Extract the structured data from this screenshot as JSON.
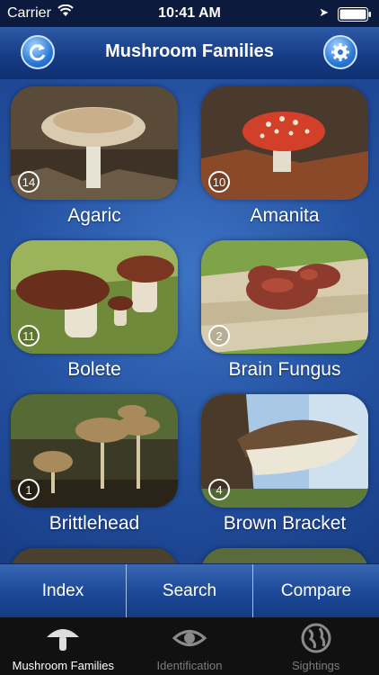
{
  "status_bar": {
    "carrier": "Carrier",
    "time": "10:41 AM"
  },
  "nav": {
    "title": "Mushroom Families"
  },
  "families": [
    {
      "name": "Agaric",
      "count": "14"
    },
    {
      "name": "Amanita",
      "count": "10"
    },
    {
      "name": "Bolete",
      "count": "11"
    },
    {
      "name": "Brain Fungus",
      "count": "2"
    },
    {
      "name": "Brittlehead",
      "count": "1"
    },
    {
      "name": "Brown Bracket",
      "count": "4"
    }
  ],
  "toolbar": {
    "index": "Index",
    "search": "Search",
    "compare": "Compare"
  },
  "tabs": [
    {
      "label": "Mushroom Families",
      "icon": "mushroom-icon",
      "active": true
    },
    {
      "label": "Identification",
      "icon": "eye-icon",
      "active": false
    },
    {
      "label": "Sightings",
      "icon": "globe-icon",
      "active": false
    }
  ],
  "colors": {
    "navbar": "#1d4a99",
    "background": "#2553a3",
    "tabbar": "#111111"
  }
}
